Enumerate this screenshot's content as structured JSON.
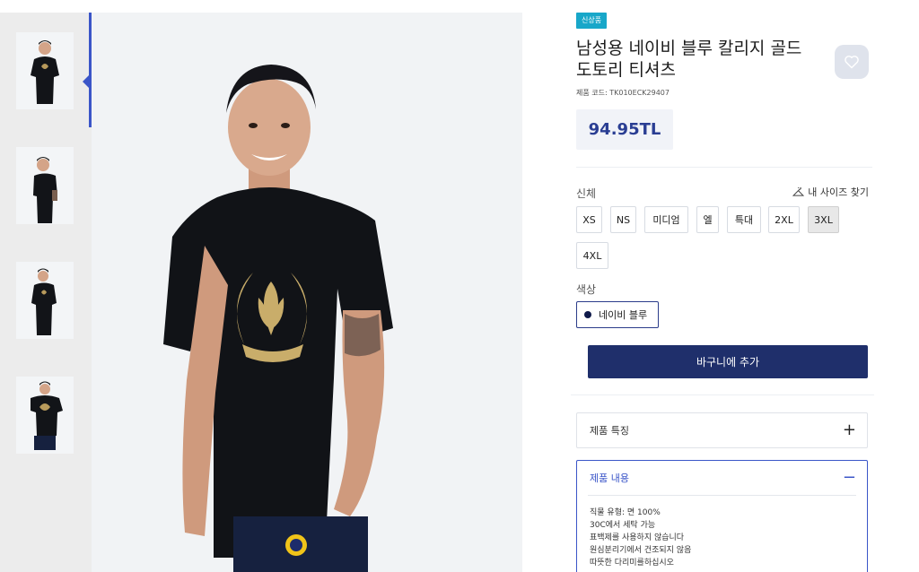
{
  "badge": "신상품",
  "title": "남성용 네이비 블루 칼리지 골드 도토리 티셔츠",
  "product_code": {
    "label": "제품 코드:",
    "value": "TK010ECK29407"
  },
  "price": "94.95TL",
  "size": {
    "label": "신체",
    "guide_label": "내 사이즈 찾기",
    "options": [
      "XS",
      "NS",
      "미디엄",
      "엘",
      "특대",
      "2XL",
      "3XL",
      "4XL"
    ],
    "selected": "3XL"
  },
  "color": {
    "label": "색상",
    "selected": "네이비 블루",
    "swatch": "#0f1a4a"
  },
  "cart_button": "바구니에 추가",
  "accordion": [
    {
      "title": "제품 특징",
      "toggle": "+",
      "open": false
    },
    {
      "title": "제품 내용",
      "toggle": "−",
      "open": true,
      "lines": [
        "직물 유형: 면 100%",
        "30C에서 세탁 가능",
        "표백제를 사용하지 않습니다",
        "원심분리기에서 건조되지 않음",
        "따뜻한 다리미를하십시오"
      ]
    }
  ],
  "colors": {
    "accent": "#2a3e93",
    "cart": "#1f2f6b",
    "badge": "#18a7c9"
  }
}
